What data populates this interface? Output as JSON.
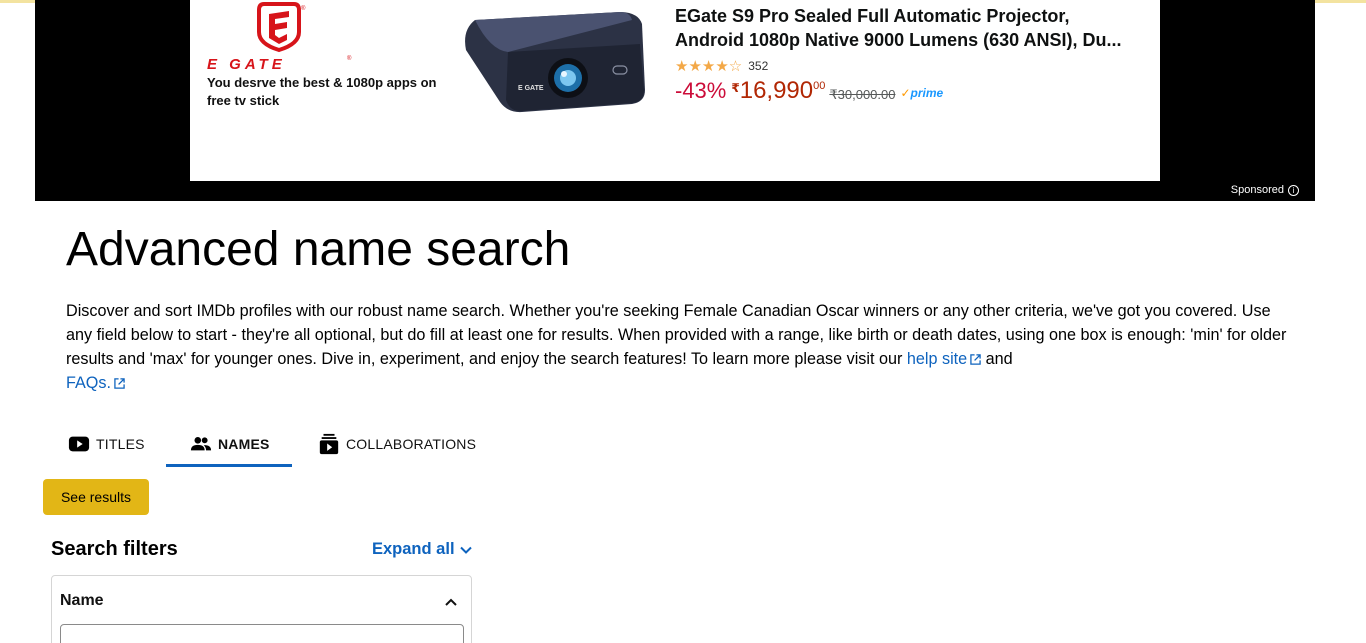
{
  "ad": {
    "brand_tagline": "You desrve the best & 1080p apps on free tv stick",
    "product_title_line1": "EGate S9 Pro Sealed Full Automatic Projector,",
    "product_title_line2": "Android 1080p Native 9000 Lumens (630 ANSI), Du...",
    "rating": 4,
    "rating_glyphs": "★★★★☆",
    "rating_count": "352",
    "discount": "-43%",
    "currency": "₹",
    "price_whole": "16,990",
    "price_fraction": "00",
    "mrp": "₹30,000.00",
    "prime_label": "prime",
    "sponsored_label": "Sponsored",
    "sponsored_icon": "info-icon",
    "colors": {
      "discount": "#cc0c39",
      "price": "#b12704",
      "brand_red": "#d7141a",
      "prime": "#1a98ff"
    }
  },
  "page": {
    "title": "Advanced name search",
    "intro_text": "Discover and sort IMDb profiles with our robust name search. Whether you're seeking Female Canadian Oscar winners or any other criteria, we've got you covered. Use any field below to start - they're all optional, but do fill at least one for results. When provided with a range, like birth or death dates, using one box is enough: 'min' for older results and 'max' for younger ones. Dive in, experiment, and enjoy the search features! To learn more please visit our ",
    "help_link": "help site",
    "and_text": " and",
    "faq_link": "FAQs.",
    "external_icon": "external-link-icon"
  },
  "tabs": [
    {
      "label": "TITLES",
      "icon": "video-play-icon",
      "active": false
    },
    {
      "label": "NAMES",
      "icon": "people-icon",
      "active": true
    },
    {
      "label": "COLLABORATIONS",
      "icon": "collaborations-icon",
      "active": false
    }
  ],
  "actions": {
    "see_results": "See results"
  },
  "filters": {
    "title": "Search filters",
    "expand_all": "Expand all",
    "name_panel": {
      "label": "Name",
      "input_value": "",
      "input_placeholder": ""
    }
  },
  "colors": {
    "accent_link": "#0e63be",
    "button_yellow": "#e2b616"
  }
}
